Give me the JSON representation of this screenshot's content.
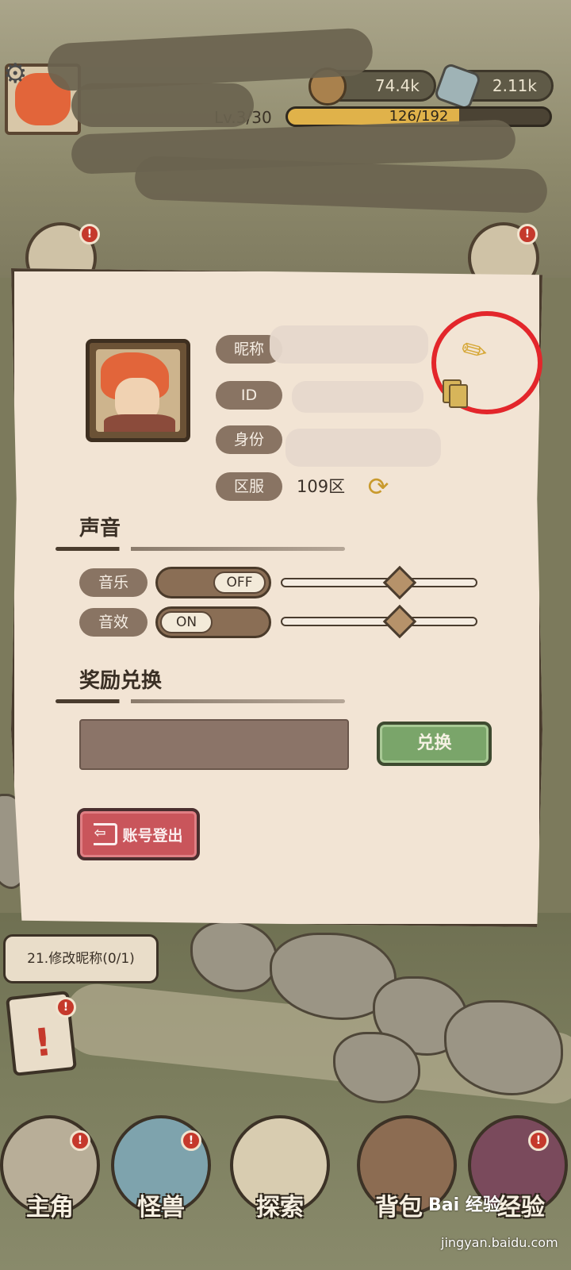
{
  "hud": {
    "coins": "74.4k",
    "gems": "2.11k",
    "level": "Lv.3/30",
    "exp_text": "126/192",
    "exp_fraction": 0.656
  },
  "profile": {
    "nickname_label": "昵称",
    "id_label": "ID",
    "identity_label": "身份",
    "server_label": "区服",
    "server_value": "109区"
  },
  "sound": {
    "title": "声音",
    "music_label": "音乐",
    "music_toggle": "OFF",
    "music_volume": 0.62,
    "sfx_label": "音效",
    "sfx_toggle": "ON",
    "sfx_volume": 0.62
  },
  "redeem": {
    "title": "奖励兑换",
    "input_value": "",
    "button_label": "兑换"
  },
  "logout_label": "账号登出",
  "task_bubble": "21.修改昵称(0/1)",
  "nav": {
    "hero": "主角",
    "monster": "怪兽",
    "explore": "探索",
    "bag": "背包",
    "codex": "经验"
  },
  "watermark": {
    "brand": "Bai 经验",
    "url": "jingyan.baidu.com"
  },
  "colors": {
    "panel_bg": "#f2e4d4",
    "label_pill": "#897463",
    "redeem_green": "#7aa56a",
    "logout_red": "#c9555b",
    "highlight_circle": "#e3262b",
    "notification": "#c5392c"
  }
}
